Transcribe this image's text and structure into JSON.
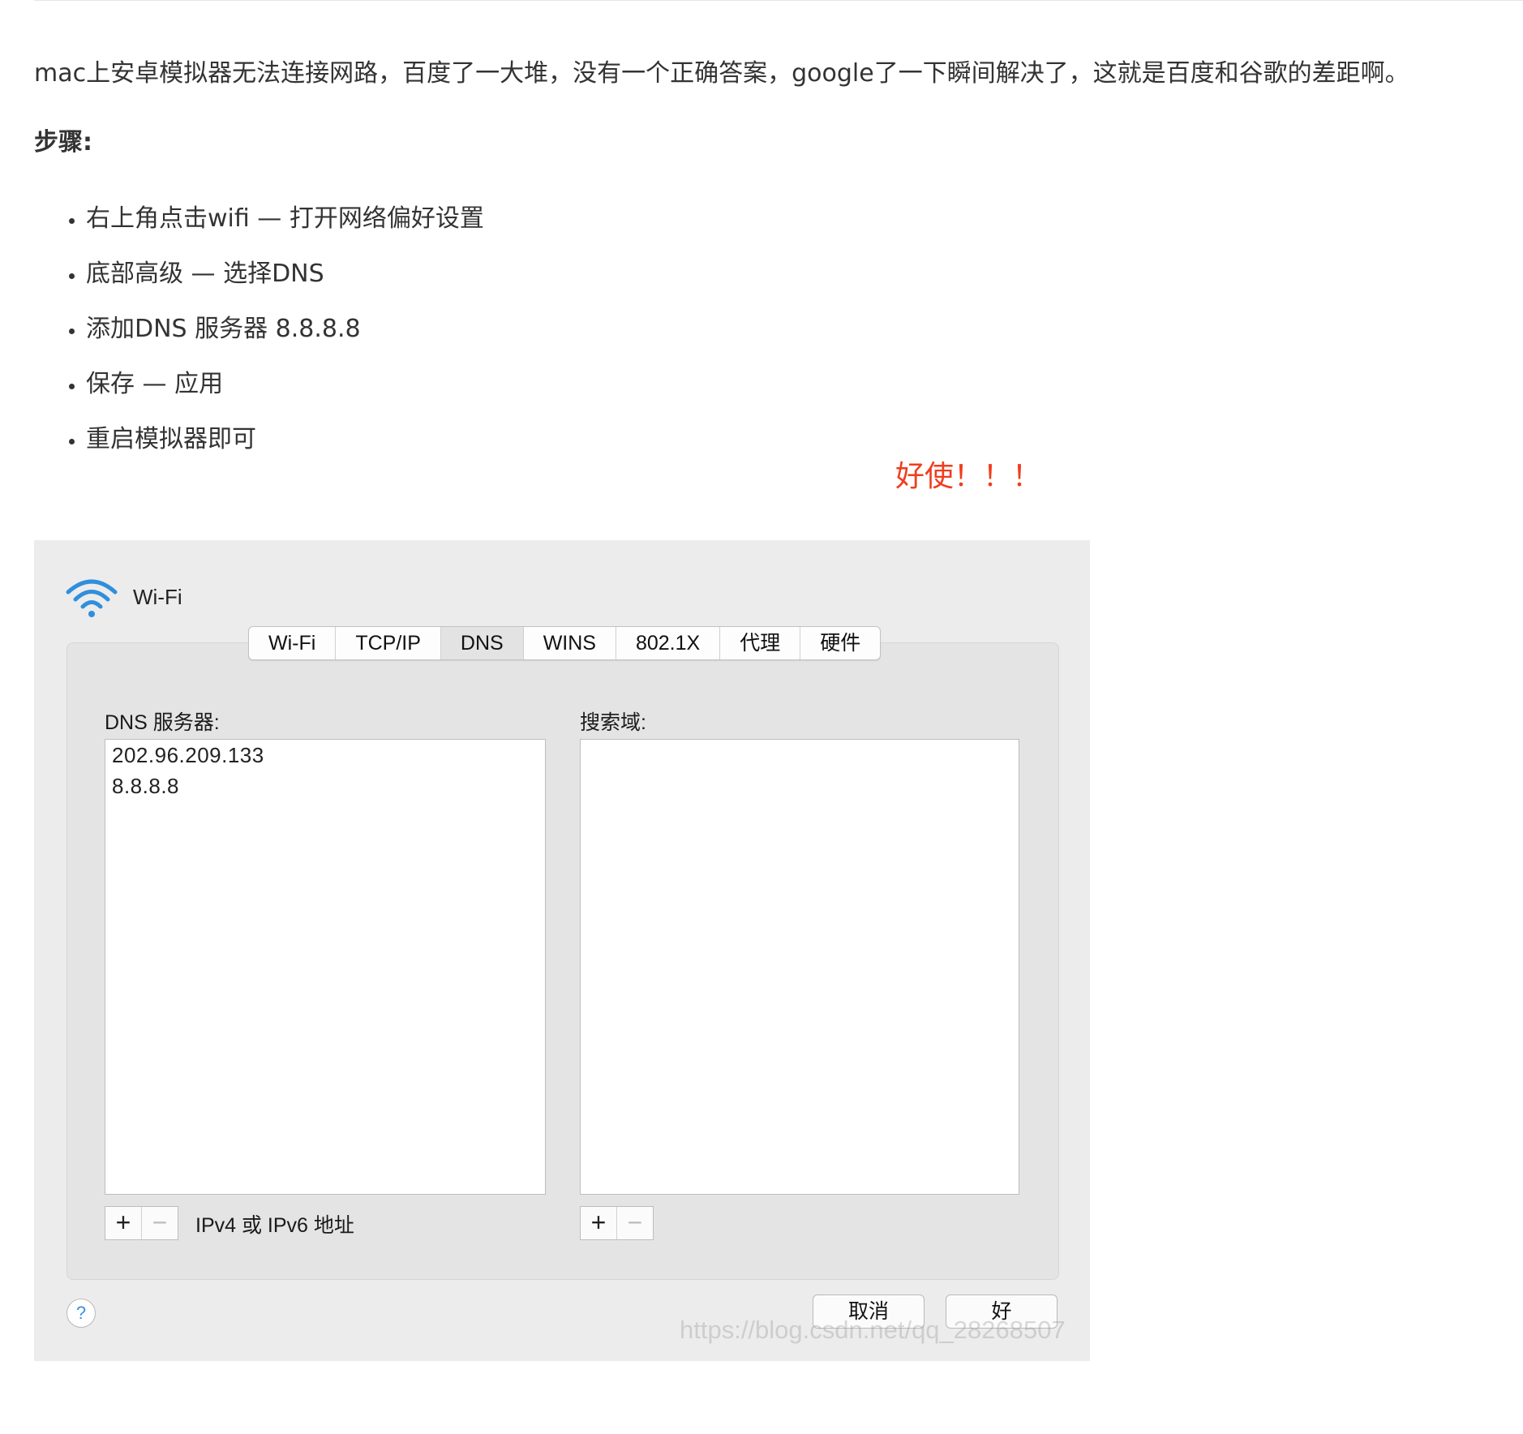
{
  "article": {
    "intro": "mac上安卓模拟器无法连接网路，百度了一大堆，没有一个正确答案，google了一下瞬间解决了，这就是百度和谷歌的差距啊。",
    "steps_heading": "步骤:",
    "steps": [
      "右上角点击wifi — 打开网络偏好设置",
      "底部高级 — 选择DNS",
      "添加DNS 服务器 8.8.8.8",
      "保存 — 应用",
      "重启模拟器即可"
    ],
    "exclaim": "好使！！！",
    "exclaim_color": "#f03c1e"
  },
  "dialog": {
    "title": "Wi-Fi",
    "tabs": [
      "Wi-Fi",
      "TCP/IP",
      "DNS",
      "WINS",
      "802.1X",
      "代理",
      "硬件"
    ],
    "active_tab": "DNS",
    "dns": {
      "label": "DNS 服务器:",
      "entries": [
        "202.96.209.133",
        "8.8.8.8"
      ],
      "add": "+",
      "remove": "−",
      "hint": "IPv4 或 IPv6 地址"
    },
    "search": {
      "label": "搜索域:",
      "add": "+",
      "remove": "−"
    },
    "help": "?",
    "cancel": "取消",
    "ok": "好",
    "watermark": "https://blog.csdn.net/qq_28268507",
    "wifi_icon_color": "#2f8fdc"
  }
}
